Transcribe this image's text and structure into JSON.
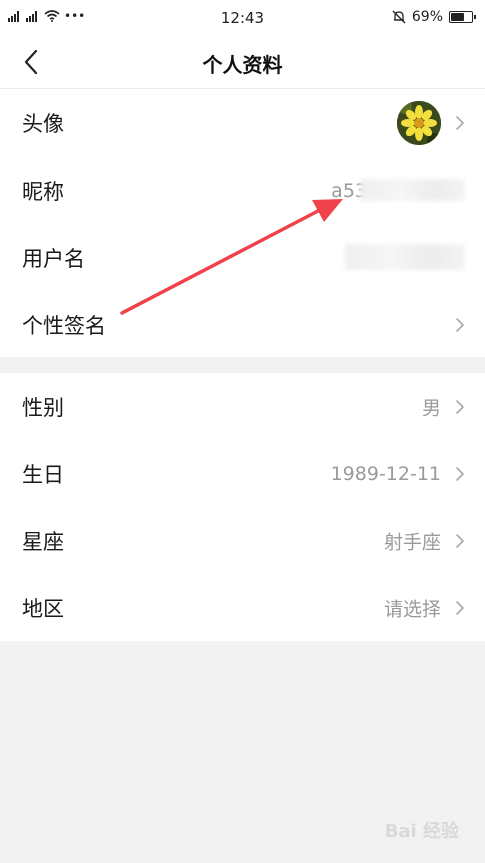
{
  "status_bar": {
    "signal_text": "•••",
    "time": "12:43",
    "battery": "69%",
    "battery_level": 0.69
  },
  "header": {
    "title": "个人资料"
  },
  "profile": {
    "rows": [
      {
        "label": "头像"
      },
      {
        "label": "昵称",
        "value": "a53"
      },
      {
        "label": "用户名"
      },
      {
        "label": "个性签名"
      }
    ]
  },
  "details": {
    "rows": [
      {
        "label": "性别",
        "value": "男"
      },
      {
        "label": "生日",
        "value": "1989-12-11"
      },
      {
        "label": "星座",
        "value": "射手座"
      },
      {
        "label": "地区",
        "value": "请选择"
      }
    ]
  },
  "watermark": "Bai 经验",
  "colors": {
    "accent_arrow": "#f0424a",
    "secondary_text": "#9a9a9a",
    "background": "#f2f2f2"
  }
}
